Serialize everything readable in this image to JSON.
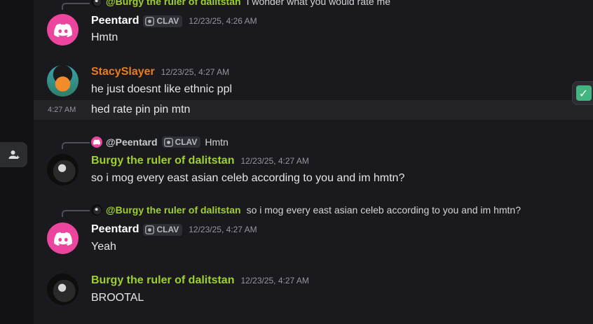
{
  "colors": {
    "accent_pink": "#eb459e",
    "name_orange": "#e67e22",
    "name_green": "#9fd02f",
    "check_green": "#43b581"
  },
  "top_reply": {
    "name": "@Burgy the ruler of dalitstan",
    "text": "I wonder what you would rate me"
  },
  "msg1": {
    "author": "Peentard",
    "tag": "CLAV",
    "timestamp": "12/23/25, 4:26 AM",
    "text": "Hmtn",
    "avatar_icon": "discord-logo-icon"
  },
  "msg2": {
    "author": "StacySlayer",
    "timestamp": "12/23/25, 4:27 AM",
    "text": "he just doesnt like ethnic ppl"
  },
  "msg2b": {
    "hover_time": "4:27 AM",
    "text": "hed rate pin pin mtn"
  },
  "msg3": {
    "reply_name": "@Peentard",
    "reply_tag": "CLAV",
    "reply_text": "Hmtn",
    "author": "Burgy the ruler of dalitstan",
    "timestamp": "12/23/25, 4:27 AM",
    "text": "so i mog every east asian celeb according to you and im hmtn?"
  },
  "msg4": {
    "reply_name": "@Burgy the ruler of dalitstan",
    "reply_text": "so i mog every east asian celeb according to you and im hmtn?",
    "author": "Peentard",
    "tag": "CLAV",
    "timestamp": "12/23/25, 4:27 AM",
    "text": "Yeah"
  },
  "msg5": {
    "author": "Burgy the ruler of dalitstan",
    "timestamp": "12/23/25, 4:27 AM",
    "text": "BROOTAL"
  },
  "side": {
    "add_friend_icon": "add-user-icon",
    "reaction_emoji": "✓"
  }
}
